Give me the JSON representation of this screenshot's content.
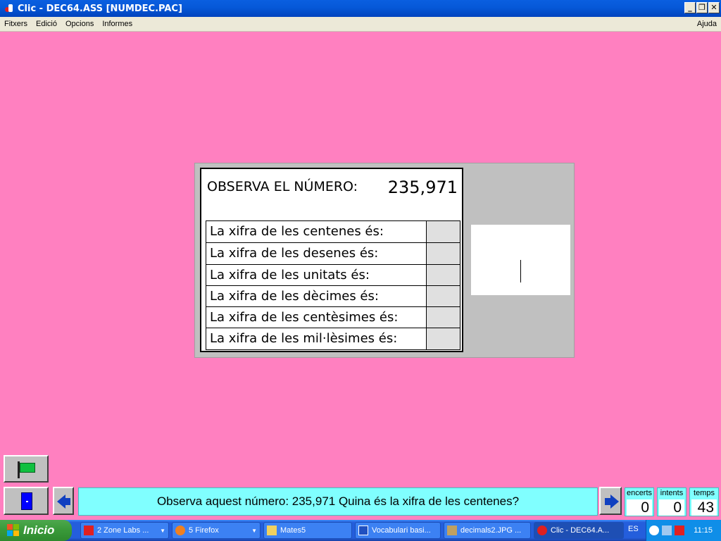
{
  "window": {
    "title": "Clic - DEC64.ASS [NUMDEC.PAC]",
    "minimize": "_",
    "restore": "❐",
    "close": "✕"
  },
  "menu": {
    "items": [
      "Fitxers",
      "Edició",
      "Opcions",
      "Informes"
    ],
    "help": "Ajuda"
  },
  "activity": {
    "heading": "OBSERVA EL NÚMERO:",
    "number": "235,971",
    "rows": [
      "La xifra de les centenes és:",
      "La xifra de les desenes és:",
      "La xifra de les unitats és:",
      "La xifra de les dècimes és:",
      "La xifra de les centèsimes és:",
      "La xifra de les mil·lèsimes és:"
    ]
  },
  "message": "Observa aquest número: 235,971   Quina és la xifra de les centenes?",
  "counters": {
    "encerts": {
      "label": "encerts",
      "value": "0"
    },
    "intents": {
      "label": "intents",
      "value": "0"
    },
    "temps": {
      "label": "temps",
      "value": "43"
    }
  },
  "taskbar": {
    "start": "Inicio",
    "tasks": [
      {
        "label": "2 Zone Labs ...",
        "icon": "zonealarm-icon",
        "group": true
      },
      {
        "label": "5 Firefox",
        "icon": "firefox-icon",
        "group": true
      },
      {
        "label": "Mates5",
        "icon": "folder-icon",
        "group": false
      },
      {
        "label": "Vocabulari basi...",
        "icon": "word-icon",
        "group": false
      },
      {
        "label": "decimals2.JPG ...",
        "icon": "image-viewer-icon",
        "group": false
      },
      {
        "label": "Clic - DEC64.A...",
        "icon": "clic-icon",
        "group": false
      }
    ],
    "lang": "ES",
    "clock": "11:15"
  },
  "colors": {
    "background": "#ff80c0",
    "message_bg": "#80ffff",
    "panel": "#c0c0c0"
  }
}
